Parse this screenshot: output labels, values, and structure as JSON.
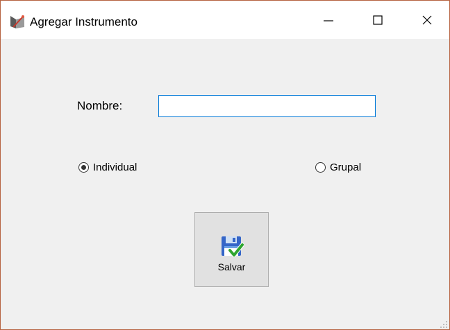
{
  "window": {
    "title": "Agregar Instrumento",
    "app_icon": "app-icon",
    "controls": [
      "minimize-icon",
      "maximize-icon",
      "close-icon"
    ]
  },
  "form": {
    "nombre_label": "Nombre:",
    "nombre_value": "",
    "nombre_placeholder": "",
    "radio_individual_label": "Individual",
    "radio_individual_checked": true,
    "radio_grupal_label": "Grupal",
    "radio_grupal_checked": false,
    "save_label": "Salvar",
    "save_icon": "save-disk-check-icon"
  },
  "colors": {
    "window_border": "#b5623f",
    "background": "#f0f0f0",
    "input_focus_border": "#0078d7",
    "button_face": "#e1e1e1"
  }
}
